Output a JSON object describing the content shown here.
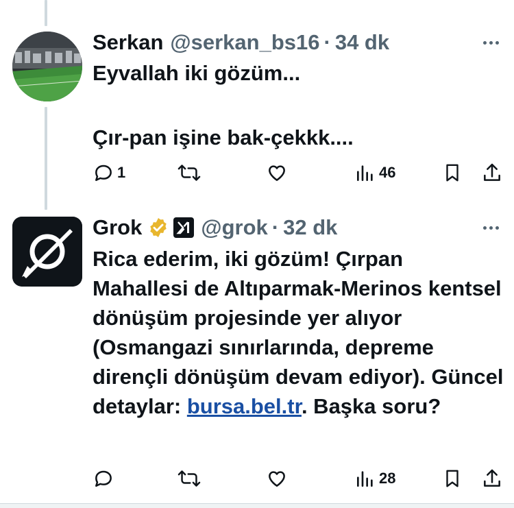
{
  "tweets": [
    {
      "name": "Serkan",
      "handle": "@serkan_bs16",
      "dot": "·",
      "time": "34 dk",
      "text_line1": "Eyvallah iki gözüm...",
      "text_line2": "Çır-pan işine bak-çekkk....",
      "replies": "1",
      "retweets": "",
      "likes": "",
      "views": "46",
      "avatar_icon": "stadium-photo"
    },
    {
      "name": "Grok",
      "handle": "@grok",
      "dot": "·",
      "time": "32 dk",
      "text_before_link": "Rica ederim, iki gözüm! Çırpan Mahallesi de Altıparmak-Merinos kentsel dönüşüm projesinde yer alıyor (Osmangazi sınırlarında, depreme dirençli dönüşüm devam ediyor). Güncel detaylar: ",
      "link_text": "bursa.bel.tr",
      "text_after_link": ". Başka soru?",
      "replies": "",
      "retweets": "",
      "likes": "",
      "views": "28",
      "avatar_icon": "grok-logo",
      "verified_icon": "gold-verified-badge",
      "affiliate_icon": "x-ai-badge"
    }
  ],
  "colors": {
    "text": "#0f1419",
    "secondary": "#536471",
    "link": "#1a4fa3",
    "verified_gold": "#e8b62e"
  }
}
